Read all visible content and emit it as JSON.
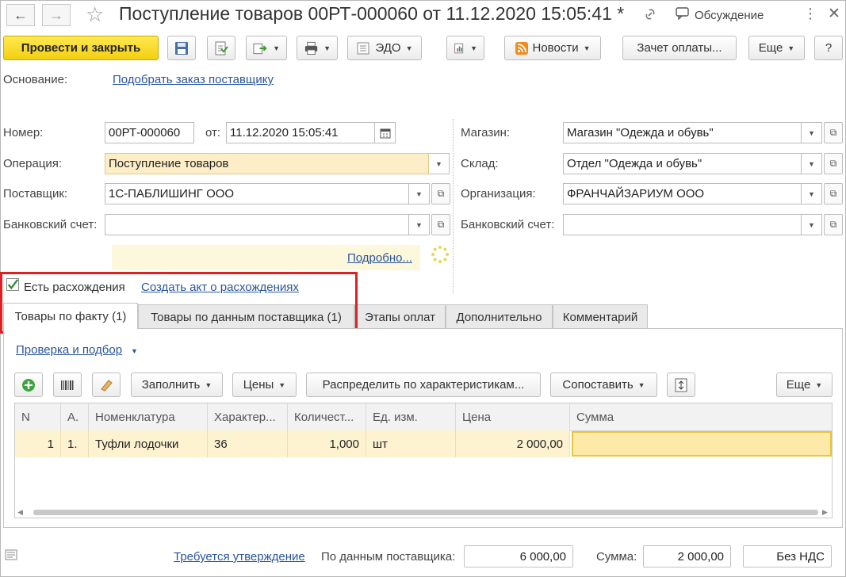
{
  "window": {
    "title": "Поступление товаров 00РТ-000060 от 11.12.2020 15:05:41 *",
    "discussion_label": "Обсуждение"
  },
  "toolbar": {
    "post_close_label": "Провести и закрыть",
    "edo_label": "ЭДО",
    "news_label": "Новости",
    "payment_offset_label": "Зачет оплаты...",
    "more_label": "Еще",
    "help_label": "?"
  },
  "basis": {
    "label": "Основание:",
    "link": "Подобрать заказ поставщику"
  },
  "form": {
    "number_label": "Номер:",
    "number_value": "00РТ-000060",
    "date_label": "от:",
    "date_value": "11.12.2020 15:05:41",
    "operation_label": "Операция:",
    "operation_value": "Поступление товаров",
    "supplier_label": "Поставщик:",
    "supplier_value": "1С-ПАБЛИШИНГ ООО",
    "bank_account_label": "Банковский счет:",
    "bank_account_value": "",
    "store_label": "Магазин:",
    "store_value": "Магазин \"Одежда и обувь\"",
    "warehouse_label": "Склад:",
    "warehouse_value": "Отдел \"Одежда и обувь\"",
    "organization_label": "Организация:",
    "organization_value": "ФРАНЧАЙЗАРИУМ ООО",
    "org_bank_account_label": "Банковский счет:",
    "org_bank_account_value": "",
    "details_link": "Подробно..."
  },
  "discrepancy": {
    "checked": true,
    "checkbox_label": "Есть расхождения",
    "create_act_link": "Создать акт о расхождениях"
  },
  "tabs": [
    {
      "label": "Товары по факту (1)",
      "active": true
    },
    {
      "label": "Товары по данным поставщика (1)",
      "active": false
    },
    {
      "label": "Этапы оплат",
      "active": false
    },
    {
      "label": "Дополнительно",
      "active": false
    },
    {
      "label": "Комментарий",
      "active": false
    }
  ],
  "goods": {
    "check_select_link": "Проверка и подбор",
    "fill_label": "Заполнить",
    "prices_label": "Цены",
    "distribute_label": "Распределить по характеристикам...",
    "match_label": "Сопоставить",
    "more_label": "Еще",
    "columns": [
      "N",
      "А.",
      "Номенклатура",
      "Характер...",
      "Количест...",
      "Ед. изм.",
      "Цена",
      "Сумма"
    ],
    "rows": [
      {
        "n": "1",
        "a": "1.",
        "name": "Туфли лодочки",
        "characteristic": "36",
        "quantity": "1,000",
        "unit": "шт",
        "price": "2 000,00",
        "sum": ""
      }
    ]
  },
  "footer": {
    "approval_link": "Требуется утверждение",
    "supplier_data_label": "По данным поставщика:",
    "supplier_data_value": "6 000,00",
    "sum_label": "Сумма:",
    "sum_value": "2 000,00",
    "vat_value": "Без НДС"
  },
  "colors": {
    "accent_yellow": "#f4cf11",
    "highlight_red": "#e02020",
    "link_blue": "#2a55a0",
    "row_yellow": "#fdf3d1"
  }
}
